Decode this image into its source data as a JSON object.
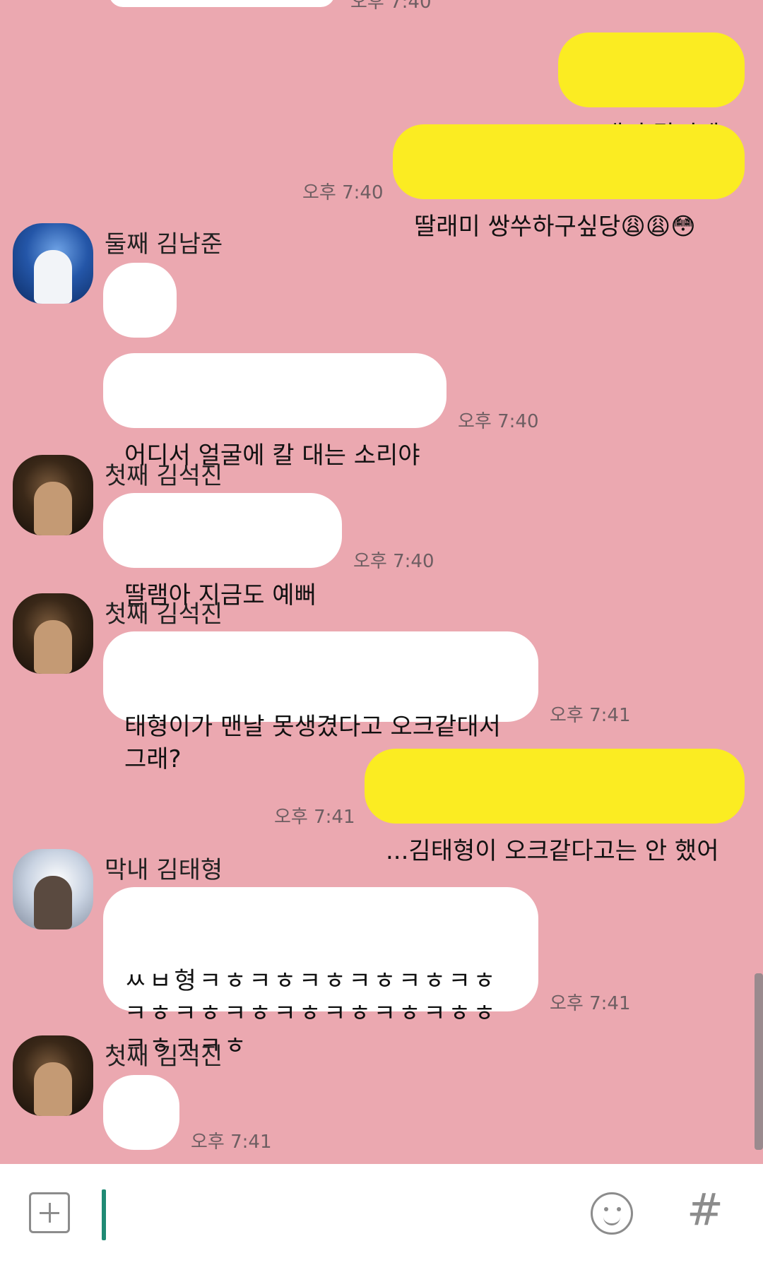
{
  "messages": [
    {
      "side": "out",
      "text": "그래서 말인데"
    },
    {
      "side": "out",
      "text": "딸래미 쌍쑤하구싶당😩😩😳",
      "time": "오후 7:40"
    },
    {
      "sender": "둘째 김남준",
      "side": "in",
      "text": "?"
    },
    {
      "side": "in",
      "text": "어디서 얼굴에 칼 대는 소리야",
      "time": "오후 7:40"
    },
    {
      "sender": "첫째 김석진",
      "side": "in",
      "text": "딸램아 지금도 예뻐",
      "time": "오후 7:40"
    },
    {
      "sender": "첫째 김석진",
      "side": "in",
      "text": "태형이가 맨날 못생겼다고 오크같대서\n그래?",
      "time": "오후 7:41"
    },
    {
      "side": "out",
      "text": "...김태형이 오크같다고는 안 했어",
      "time": "오후 7:41"
    },
    {
      "sender": "막내 김태형",
      "side": "in",
      "text": "ㅆㅂ형ㅋㅎㅋㅎㅋㅎㅋㅎㅋㅎㅋㅎ\nㅋㅎㅋㅎㅋㅎㅋㅎㅋㅎㅋㅎㅋㅎㅎ\nㅋㅎㅋㅋㅎ",
      "time": "오후 7:41"
    },
    {
      "sender": "첫째 김석진",
      "side": "in",
      "text": "😅",
      "time": "오후 7:41"
    }
  ],
  "topcut_time": "오후 7:40",
  "input": {
    "placeholder": ""
  },
  "icons": {
    "attach": "plus-square-icon",
    "emoji": "smiley-icon",
    "hashtag": "hashtag-icon"
  },
  "colors": {
    "background": "#eba8b0",
    "incoming": "#ffffff",
    "outgoing": "#fbec22"
  }
}
